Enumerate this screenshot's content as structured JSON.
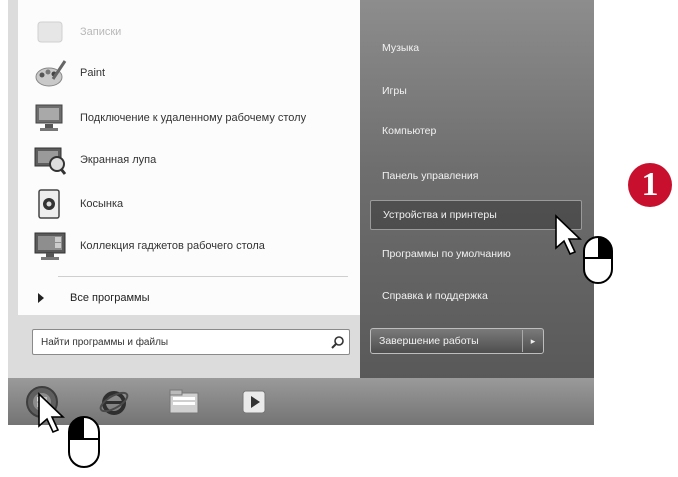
{
  "left_programs": [
    {
      "label": "Записки",
      "icon": "sticky-notes-icon",
      "faded": true
    },
    {
      "label": "Paint",
      "icon": "paint-icon",
      "faded": false
    },
    {
      "label": "Подключение к удаленному рабочему столу",
      "icon": "remote-desktop-icon",
      "faded": false
    },
    {
      "label": "Экранная лупа",
      "icon": "magnifier-app-icon",
      "faded": false
    },
    {
      "label": "Косынка",
      "icon": "solitaire-icon",
      "faded": false
    },
    {
      "label": "Коллекция гаджетов рабочего стола",
      "icon": "gadgets-icon",
      "faded": false
    }
  ],
  "all_programs_label": "Все программы",
  "search_placeholder": "Найти программы и файлы",
  "right_items": [
    {
      "label": "Музыка"
    },
    {
      "label": "Игры"
    },
    {
      "label": "Компьютер"
    },
    {
      "label": "Панель управления"
    },
    {
      "label": "Устройства и принтеры",
      "highlighted": true
    },
    {
      "label": "Программы по умолчанию"
    },
    {
      "label": "Справка и поддержка"
    }
  ],
  "shutdown_label": "Завершение работы",
  "step_badge": "1",
  "taskbar_items": [
    "start-orb-icon",
    "internet-explorer-icon",
    "file-explorer-icon",
    "media-player-icon"
  ]
}
